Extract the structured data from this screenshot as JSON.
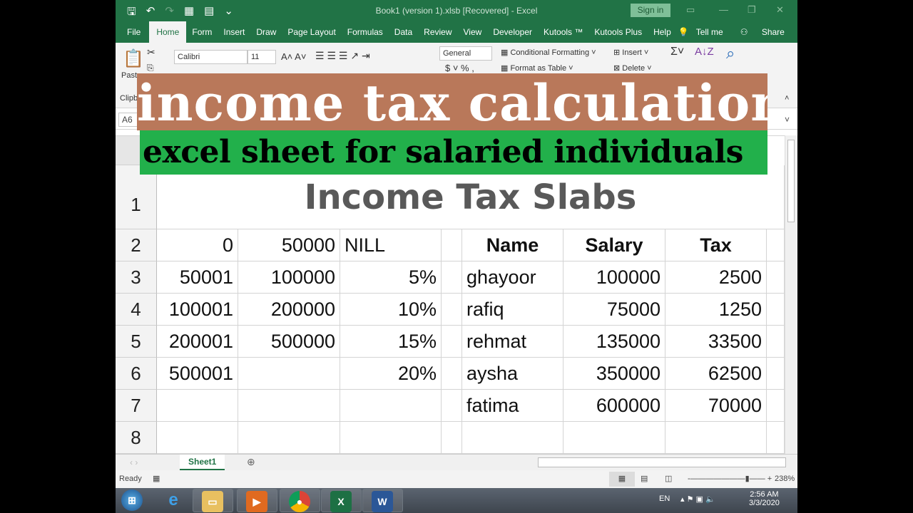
{
  "titlebar": {
    "title": "Book1 (version 1).xlsb [Recovered]  -  Excel",
    "sign_in": "Sign in"
  },
  "tabs": [
    "File",
    "Home",
    "Form",
    "Insert",
    "Draw",
    "Page Layout",
    "Formulas",
    "Data",
    "Review",
    "View",
    "Developer",
    "Kutools ™",
    "Kutools Plus",
    "Help",
    "Tell me",
    "Share"
  ],
  "ribbon": {
    "paste": "Paste",
    "clipboard": "Clipb",
    "font": "Calibri",
    "size": "11",
    "number_format": "General",
    "conditional": "Conditional Formatting",
    "format_table": "Format as Table",
    "insert": "Insert",
    "delete": "Delete"
  },
  "name_box": "A6",
  "banner": {
    "line1": "income tax calculation",
    "line2": "excel sheet for salaried individuals"
  },
  "sheet": {
    "title": "Income Tax Slabs",
    "row_numbers": [
      "1",
      "2",
      "3",
      "4",
      "5",
      "6",
      "7",
      "8"
    ],
    "slabs": [
      [
        "0",
        "50000",
        "NILL"
      ],
      [
        "50001",
        "100000",
        "5%"
      ],
      [
        "100001",
        "200000",
        "10%"
      ],
      [
        "200001",
        "500000",
        "15%"
      ],
      [
        "500001",
        "",
        "20%"
      ]
    ],
    "headers": [
      "Name",
      "Salary",
      "Tax"
    ],
    "people": [
      [
        "ghayoor",
        "100000",
        "2500"
      ],
      [
        "rafiq",
        "75000",
        "1250"
      ],
      [
        "rehmat",
        "135000",
        "33500"
      ],
      [
        "aysha",
        "350000",
        "62500"
      ],
      [
        "fatima",
        "600000",
        "70000"
      ]
    ]
  },
  "sheet_tab": "Sheet1",
  "status": {
    "ready": "Ready",
    "zoom": "238%"
  },
  "taskbar": {
    "lang": "EN",
    "time": "2:56 AM",
    "date": "3/3/2020"
  },
  "colors": {
    "excel_green": "#217346",
    "banner_brown": "#b9785a",
    "banner_green": "#22b04b"
  }
}
